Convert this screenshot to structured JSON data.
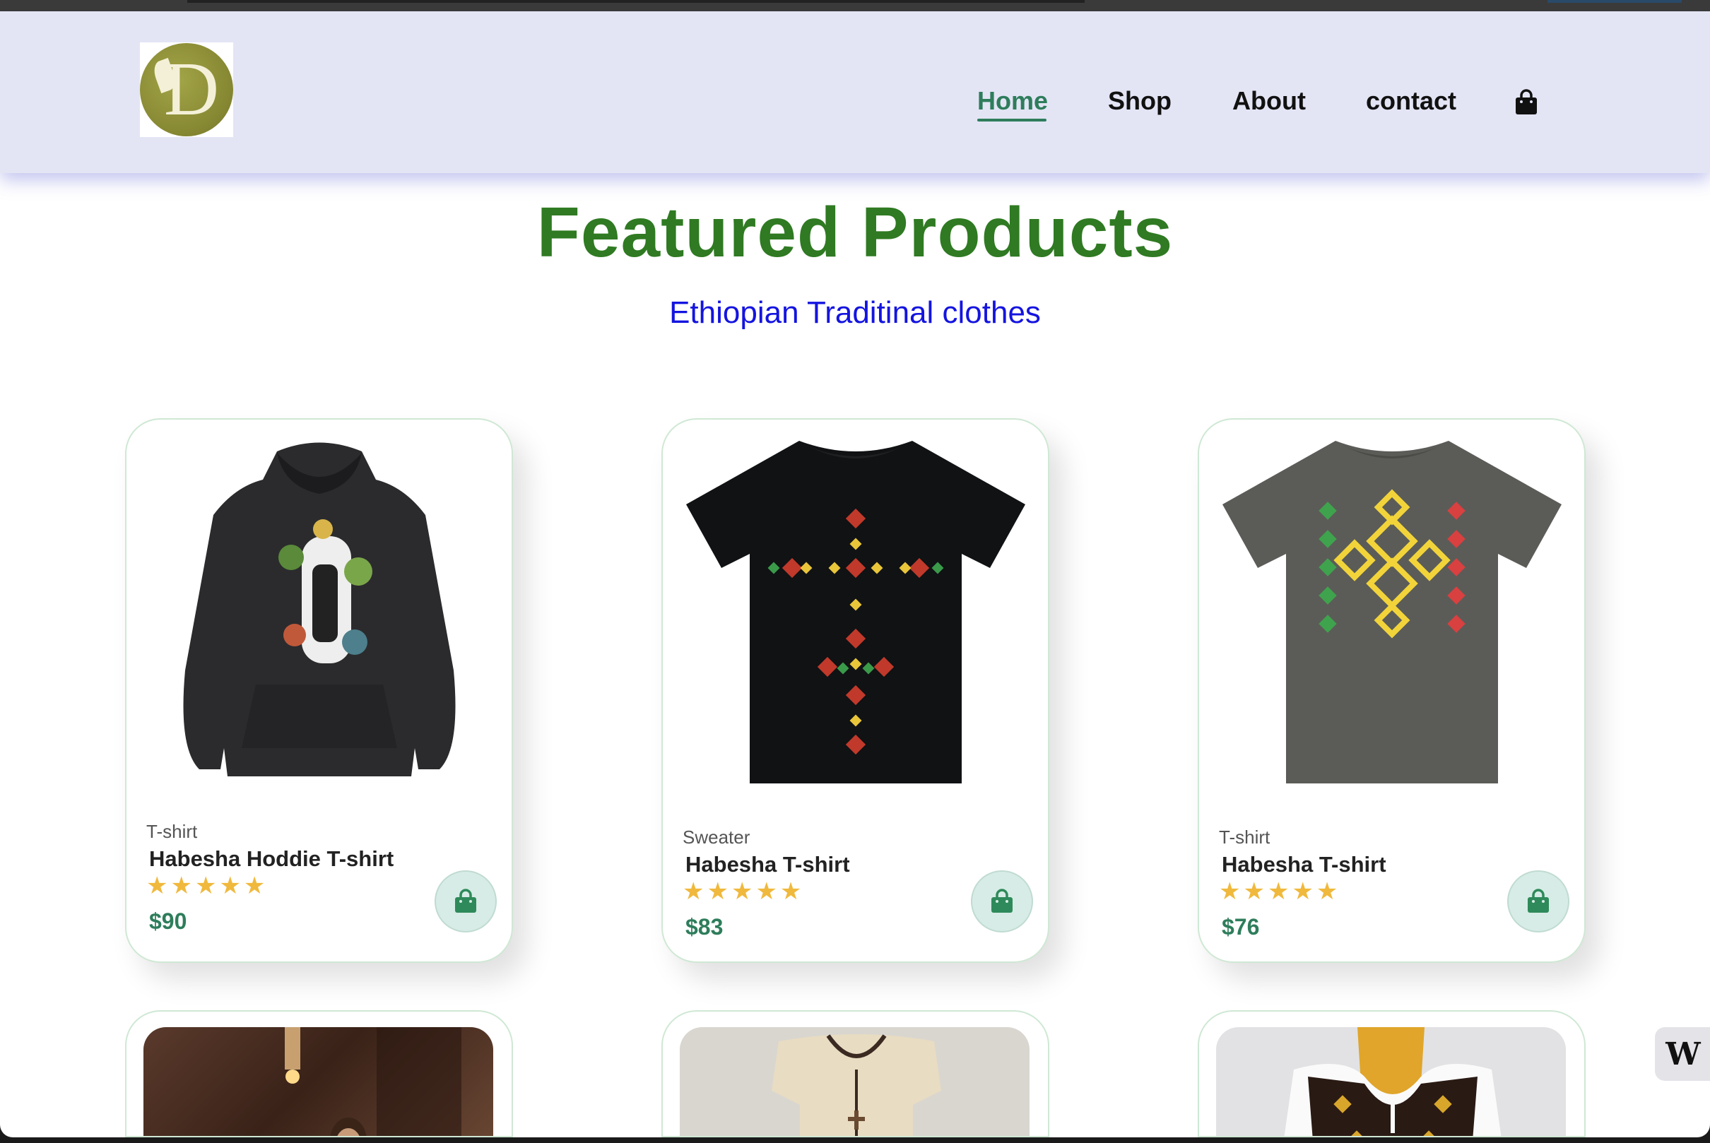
{
  "header": {
    "logo_alt": "D",
    "nav": [
      {
        "label": "Home",
        "active": true
      },
      {
        "label": "Shop",
        "active": false
      },
      {
        "label": "About",
        "active": false
      },
      {
        "label": "contact",
        "active": false
      }
    ],
    "cart_icon": "shopping-bag-icon"
  },
  "hero": {
    "title": "Featured Products",
    "subtitle": "Ethiopian Traditinal clothes"
  },
  "products": [
    {
      "category": "T-shirt",
      "name": "Habesha Hoddie T-shirt",
      "rating": "★★★★★",
      "price": "$90",
      "image": "black-hoodie"
    },
    {
      "category": "Sweater",
      "name": "Habesha T-shirt",
      "rating": "★★★★★",
      "price": "$83",
      "image": "black-tshirt-cross"
    },
    {
      "category": "T-shirt",
      "name": "Habesha T-shirt",
      "rating": "★★★★★",
      "price": "$76",
      "image": "grey-tshirt-cross"
    }
  ],
  "widget": {
    "label": "W"
  },
  "colors": {
    "nav_bg": "#e3e5f5",
    "accent_green": "#2e7d5b",
    "heading_green": "#2f7a22",
    "subtitle_blue": "#1414e0",
    "star": "#f0b93d"
  }
}
